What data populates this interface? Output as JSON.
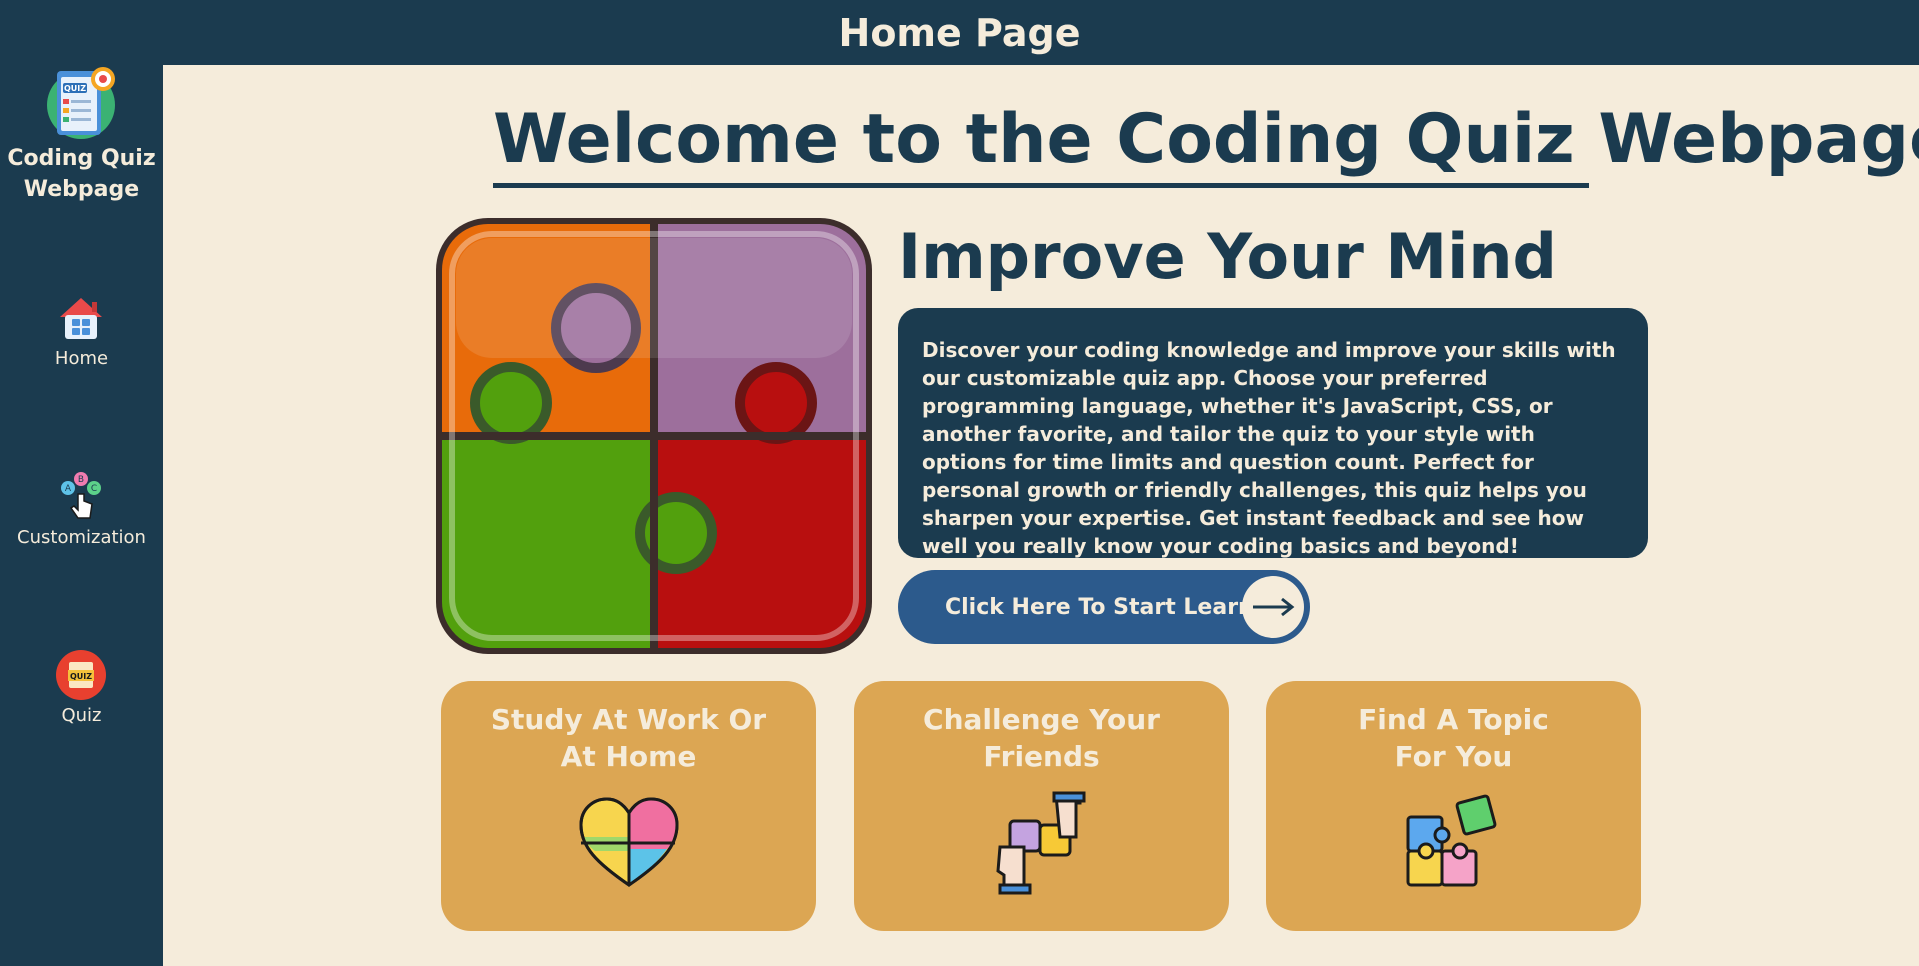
{
  "header": {
    "title": "Home Page"
  },
  "sidebar": {
    "brand": {
      "line1": "Coding Quiz",
      "line2": "Webpage",
      "logo_icon": "quiz-logo-icon"
    },
    "items": [
      {
        "label": "Home",
        "icon": "home-icon"
      },
      {
        "label": "Customization",
        "icon": "abc-pointer-icon"
      },
      {
        "label": "Quiz",
        "icon": "quiz-icon"
      }
    ]
  },
  "main": {
    "welcome": "Welcome to the Coding Quiz Webpage",
    "hero_icon": "puzzle-hero-icon",
    "heading": "Improve Your Mind",
    "description": "Discover your coding knowledge and improve your skills with our customizable quiz app. Choose your preferred programming language, whether it's JavaScript, CSS, or another favorite, and tailor the quiz to your style with options for time limits and question count. Perfect for personal growth or friendly challenges, this quiz helps you sharpen your expertise. Get instant feedback and see how well you really know your coding basics and beyond!",
    "cta": {
      "label": "Click Here To Start Learning",
      "arrow": "→"
    },
    "cards": [
      {
        "line1": "Study At Work Or",
        "line2": "At Home",
        "icon": "puzzle-heart-icon"
      },
      {
        "line1": "Challenge Your",
        "line2": "Friends",
        "icon": "puzzle-hands-icon"
      },
      {
        "line1": "Find A Topic",
        "line2": "For You",
        "icon": "puzzle-pieces-icon"
      }
    ]
  },
  "colors": {
    "navy": "#1b3b4f",
    "cream": "#f5ecdb",
    "card": "#dca653",
    "button": "#2c5a8c"
  }
}
